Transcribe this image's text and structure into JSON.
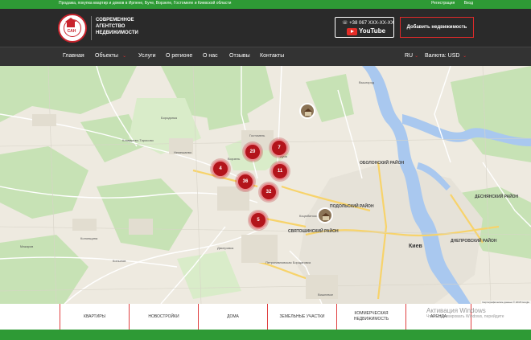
{
  "topbar": {
    "tagline": "Продажа, покупка квартир и домов в Ирпене, Буче, Ворзеле, Гостомеле и Киевской области",
    "register": "Регистрация",
    "login": "Вход"
  },
  "header": {
    "logo_text": "САН",
    "agency_line1": "СОВРЕМЕННОЕ",
    "agency_line2": "АГЕНТСТВО",
    "agency_line3": "НЕДВИЖИМОСТИ",
    "phone": "+38 067 XXX-XX-XX",
    "youtube_label": "YouTube",
    "add_property": "Добавить недвижимость"
  },
  "nav": {
    "items": [
      "Главная",
      "Объекты",
      "Услуги",
      "О регионе",
      "О нас",
      "Отзывы",
      "Контакты"
    ],
    "language": "RU",
    "currency_label": "Валюта:",
    "currency": "USD"
  },
  "map": {
    "clusters": [
      "20",
      "7",
      "4",
      "11",
      "36",
      "32",
      "5"
    ],
    "labels": {
      "vyshgorod": "Вышгород",
      "obolonsky": "ОБОЛОНСКИЙ РАЙОН",
      "podolsky": "ПОДОЛЬСКИЙ РАЙОН",
      "svyatoshinsky": "СВЯТОШИНСКИЙ РАЙОН",
      "kiev": "Киев",
      "desnyansky": "ДЕСНЯНСКИЙ РАЙОН",
      "dneprovsky": "ДНЕПРОВСКИЙ РАЙОН",
      "kotsyubinskoe": "Коцюбинское",
      "gostomel": "Гостомель",
      "bucha": "Буча",
      "vishneve": "Вишневое",
      "borodyanka": "Бородянка",
      "klavdievo": "Клавдиево-Тарасово",
      "makarov": "Макаров",
      "vorzel": "Ворзель",
      "nemeshaevo": "Немешаево",
      "petropavlovskaya": "Петропавловская Борщаговка",
      "kopyliv": "Копылов",
      "kolonshchina": "Колонщина",
      "dmitrovka": "Дмитровка"
    },
    "copyright": "Картографические данные © 2018 Google"
  },
  "categories": [
    "КВАРТИРЫ",
    "НОВОСТРОЙКИ",
    "ДОМА",
    "ЗЕМЕЛЬНЫЕ УЧАСТКИ",
    "КОММЕРЧЕСКАЯ НЕДВИЖИМОСТЬ",
    "АРЕНДА"
  ],
  "watermark": {
    "line1": "Активация Windows",
    "line2": "Чтобы активировать Windows, перейдите"
  }
}
